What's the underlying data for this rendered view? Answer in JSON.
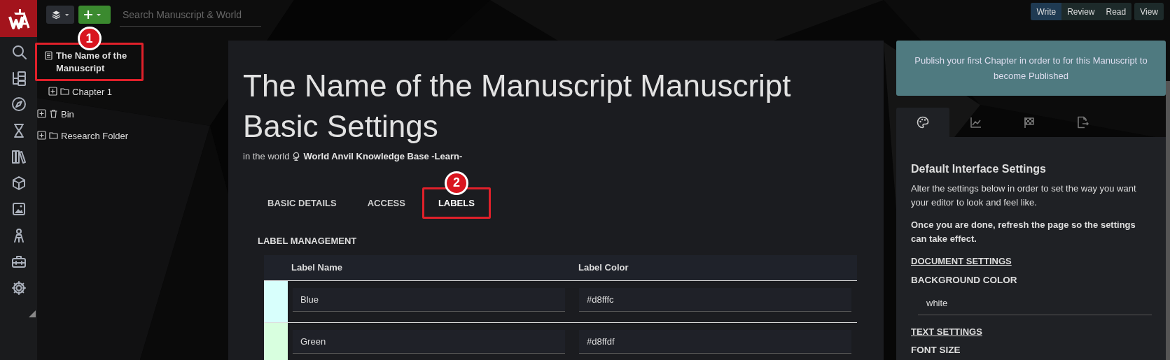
{
  "top_bar": {
    "search": {
      "placeholder": "Search Manuscript & World"
    },
    "modes": [
      {
        "label": "Write",
        "selected": true
      },
      {
        "label": "Review",
        "selected": false
      },
      {
        "label": "Read",
        "selected": false
      }
    ],
    "view_button": "View"
  },
  "tree": [
    {
      "label": "The Name of the Manuscript",
      "kind": "manuscript",
      "callout": "1",
      "children": [
        {
          "label": "Chapter 1",
          "kind": "folder",
          "expanded": false
        }
      ]
    },
    {
      "label": "Bin",
      "kind": "bin",
      "expanded": false
    },
    {
      "label": "Research Folder",
      "kind": "folder",
      "expanded": false
    }
  ],
  "main": {
    "title": "The Name of the Manuscript Manuscript Basic Settings",
    "world_prefix": "in the world",
    "world_name": "World Anvil Knowledge Base -Learn-",
    "tabs": [
      {
        "label": "BASIC DETAILS",
        "selected": false
      },
      {
        "label": "ACCESS",
        "selected": false
      },
      {
        "label": "LABELS",
        "selected": true,
        "callout": "2"
      }
    ],
    "section_title": "LABEL MANAGEMENT",
    "table": {
      "columns": [
        "Label Name",
        "Label Color"
      ],
      "rows": [
        {
          "name": "Blue",
          "value": "#d8fffc",
          "color": "#d8fffc"
        },
        {
          "name": "Green",
          "value": "#d8ffdf",
          "color": "#d8ffdf"
        }
      ]
    }
  },
  "right": {
    "notice": "Publish your first Chapter in order to for this Manuscript to become Published",
    "tabs": [
      {
        "kind": "palette",
        "selected": true
      },
      {
        "kind": "chart",
        "selected": false
      },
      {
        "kind": "flag",
        "selected": false
      },
      {
        "kind": "export",
        "selected": false
      }
    ],
    "title": "Default Interface Settings",
    "intro": "Alter the settings below in order to set the way you want your editor to look and feel like.",
    "note": "Once you are done, refresh the page so the settings can take effect.",
    "sections": [
      {
        "heading": "DOCUMENT SETTINGS",
        "fields": [
          {
            "label": "BACKGROUND COLOR",
            "value": "white"
          }
        ]
      },
      {
        "heading": "TEXT SETTINGS",
        "fields": [
          {
            "label": "FONT SIZE"
          }
        ]
      }
    ]
  }
}
